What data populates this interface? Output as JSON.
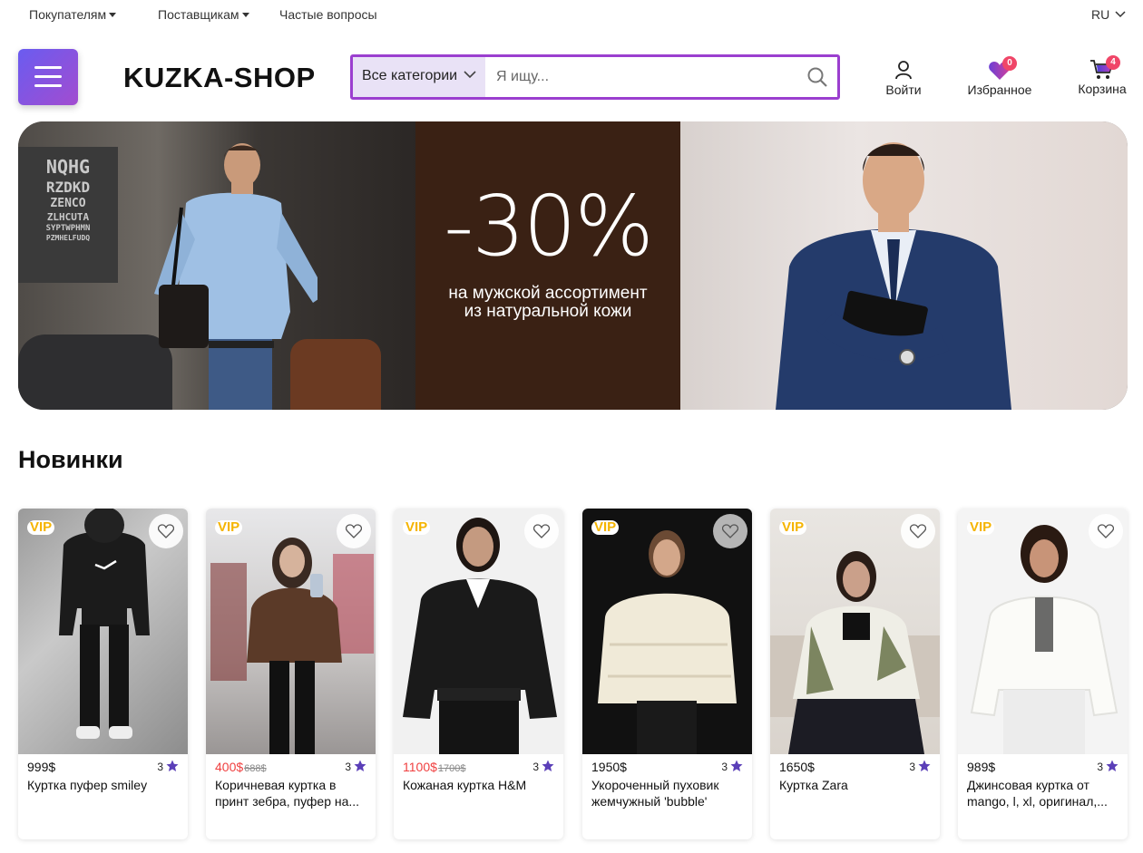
{
  "topbar": {
    "buyers": "Покупателям",
    "suppliers": "Поставщикам",
    "faq": "Частые вопросы",
    "language": "RU"
  },
  "header": {
    "logo": "KUZKA-SHOP",
    "search": {
      "category": "Все категории",
      "placeholder": "Я ищу..."
    },
    "login": "Войти",
    "favorites": "Избранное",
    "favorites_count": "0",
    "cart": "Корзина",
    "cart_count": "4"
  },
  "banner": {
    "discount": "-30%",
    "line1": "на мужской ассортимент",
    "line2": "из натуральной кожи",
    "eye_chart": [
      "NQHG",
      "RZDKD",
      "ZENCO",
      "ZLHCUTA",
      "SYPTWPHMN",
      "PZMHELFUDQ"
    ]
  },
  "section": {
    "title": "Новинки"
  },
  "products": [
    {
      "badge": "VIP",
      "price": "999$",
      "old_price": "",
      "rating": "3",
      "title": "Куртка пуфер smiley"
    },
    {
      "badge": "VIP",
      "price": "400$",
      "old_price": "688$",
      "rating": "3",
      "title": "Коричневая куртка в принт зебра, пуфер на..."
    },
    {
      "badge": "VIP",
      "price": "1100$",
      "old_price": "1700$",
      "rating": "3",
      "title": "Кожаная куртка H&M"
    },
    {
      "badge": "VIP",
      "price": "1950$",
      "old_price": "",
      "rating": "3",
      "title": "Укороченный пуховик жемчужный 'bubble'"
    },
    {
      "badge": "VIP",
      "price": "1650$",
      "old_price": "",
      "rating": "3",
      "title": "Куртка Zara"
    },
    {
      "badge": "VIP",
      "price": "989$",
      "old_price": "",
      "rating": "3",
      "title": "Джинсовая куртка от mango, l, xl, оригинал,..."
    }
  ],
  "colors": {
    "accent": "#9b3fcf",
    "badge": "#f04668",
    "vip": "#f5b400",
    "sale": "#f04040",
    "star": "#5b3fb8"
  }
}
